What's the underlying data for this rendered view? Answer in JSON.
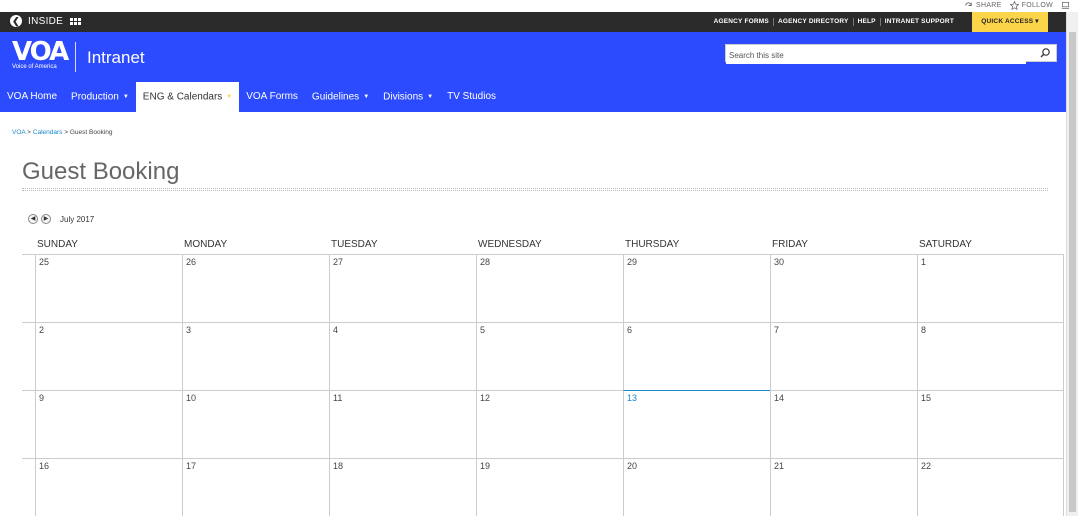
{
  "share": {
    "share_label": "SHARE",
    "follow_label": "FOLLOW"
  },
  "suite_bar": {
    "inside_label": "INSIDE",
    "links": [
      "AGENCY FORMS",
      "AGENCY DIRECTORY",
      "HELP",
      "INTRANET SUPPORT"
    ],
    "quick_access": "QUICK ACCESS ▾"
  },
  "brand": {
    "logo_mark": "VOA",
    "logo_sub": "Voice of America",
    "site_title": "Intranet",
    "search_placeholder": "Search this site"
  },
  "nav": [
    {
      "label": "VOA Home",
      "dropdown": false,
      "active": false
    },
    {
      "label": "Production",
      "dropdown": true,
      "active": false
    },
    {
      "label": "ENG & Calendars",
      "dropdown": true,
      "active": true
    },
    {
      "label": "VOA Forms",
      "dropdown": false,
      "active": false
    },
    {
      "label": "Guidelines",
      "dropdown": true,
      "active": false
    },
    {
      "label": "Divisions",
      "dropdown": true,
      "active": false
    },
    {
      "label": "TV Studios",
      "dropdown": false,
      "active": false
    }
  ],
  "breadcrumb": {
    "root": "VOA",
    "sep": " > ",
    "parent": "Calendars",
    "current": "Guest Booking"
  },
  "page_title": "Guest Booking",
  "calendar": {
    "month_label": "July 2017",
    "day_names": [
      "SUNDAY",
      "MONDAY",
      "TUESDAY",
      "WEDNESDAY",
      "THURSDAY",
      "FRIDAY",
      "SATURDAY"
    ],
    "weeks": [
      [
        "25",
        "26",
        "27",
        "28",
        "29",
        "30",
        "1"
      ],
      [
        "2",
        "3",
        "4",
        "5",
        "6",
        "7",
        "8"
      ],
      [
        "9",
        "10",
        "11",
        "12",
        "13",
        "14",
        "15"
      ],
      [
        "16",
        "17",
        "18",
        "19",
        "20",
        "21",
        "22"
      ]
    ],
    "today": "13",
    "today_color": "#1a87c9"
  },
  "colors": {
    "brand_blue": "#2c4bff",
    "accent_yellow": "#fbd449",
    "suite_dark": "#2b2b2b",
    "link_blue": "#1a87c9"
  }
}
